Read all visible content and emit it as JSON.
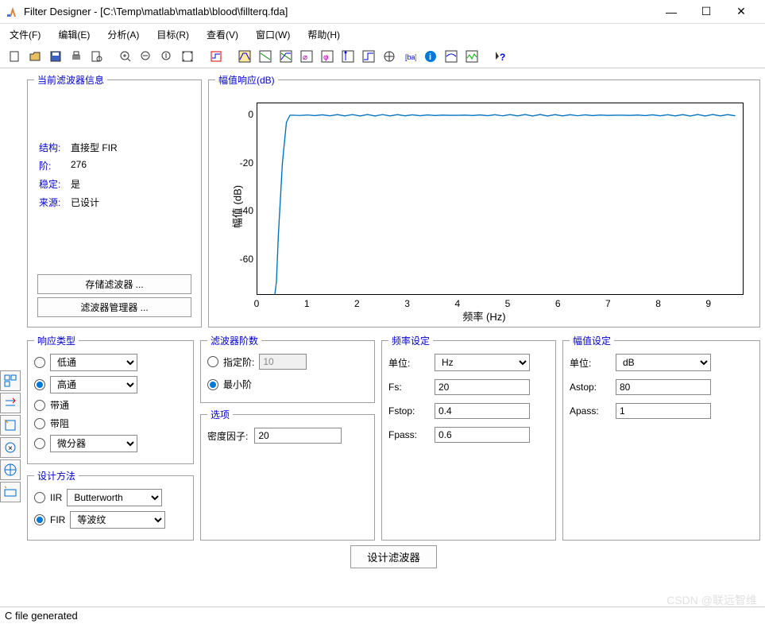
{
  "window": {
    "title": "Filter Designer -  [C:\\Temp\\matlab\\matlab\\blood\\fillterq.fda]",
    "minimize": "—",
    "maximize": "☐",
    "close": "✕"
  },
  "menu": {
    "file": "文件(F)",
    "edit": "编辑(E)",
    "analysis": "分析(A)",
    "target": "目标(R)",
    "view": "查看(V)",
    "window": "窗口(W)",
    "help": "帮助(H)"
  },
  "info_panel": {
    "title": "当前滤波器信息",
    "structure_label": "结构:",
    "structure_value": "直接型 FIR",
    "order_label": "阶:",
    "order_value": "276",
    "stable_label": "稳定:",
    "stable_value": "是",
    "source_label": "来源:",
    "source_value": "已设计",
    "save_btn": "存储滤波器 ...",
    "manager_btn": "滤波器管理器 ..."
  },
  "chart": {
    "title": "幅值响应(dB)",
    "ylabel": "幅值 (dB)",
    "xlabel": "频率 (Hz)"
  },
  "chart_data": {
    "type": "line",
    "xlabel": "频率 (Hz)",
    "ylabel": "幅值 (dB)",
    "xlim": [
      0,
      9.7
    ],
    "ylim": [
      -75,
      5
    ],
    "xticks": [
      0,
      1,
      2,
      3,
      4,
      5,
      6,
      7,
      8,
      9
    ],
    "yticks": [
      0,
      -20,
      -40,
      -60
    ],
    "x": [
      0.05,
      0.1,
      0.15,
      0.2,
      0.25,
      0.3,
      0.35,
      0.38,
      0.4,
      0.45,
      0.5,
      0.55,
      0.6,
      0.8,
      1,
      2,
      3,
      4,
      5,
      6,
      7,
      8,
      9,
      9.7
    ],
    "y": [
      -80,
      -80,
      -80,
      -80,
      -80,
      -78,
      -70,
      -62,
      -50,
      -30,
      -15,
      -5,
      0,
      0.3,
      0,
      0.3,
      0,
      0.3,
      0,
      0.3,
      0,
      0.3,
      0,
      0.3
    ]
  },
  "response_type": {
    "title": "响应类型",
    "lowpass": "低通",
    "highpass": "高通",
    "bandpass": "带通",
    "bandstop": "带阻",
    "diff": "微分器",
    "selected": "highpass"
  },
  "design_method": {
    "title": "设计方法",
    "iir_label": "IIR",
    "iir_value": "Butterworth",
    "fir_label": "FIR",
    "fir_value": "等波纹",
    "selected": "fir"
  },
  "filter_order": {
    "title": "滤波器阶数",
    "specify_label": "指定阶:",
    "specify_value": "10",
    "min_label": "最小阶",
    "selected": "min"
  },
  "options": {
    "title": "选项",
    "density_label": "密度因子:",
    "density_value": "20"
  },
  "freq_spec": {
    "title": "频率设定",
    "unit_label": "单位:",
    "unit_value": "Hz",
    "fs_label": "Fs:",
    "fs_value": "20",
    "fstop_label": "Fstop:",
    "fstop_value": "0.4",
    "fpass_label": "Fpass:",
    "fpass_value": "0.6"
  },
  "mag_spec": {
    "title": "幅值设定",
    "unit_label": "单位:",
    "unit_value": "dB",
    "astop_label": "Astop:",
    "astop_value": "80",
    "apass_label": "Apass:",
    "apass_value": "1"
  },
  "design_button": "设计滤波器",
  "status": "C file generated",
  "watermark": "CSDN @联远智维"
}
